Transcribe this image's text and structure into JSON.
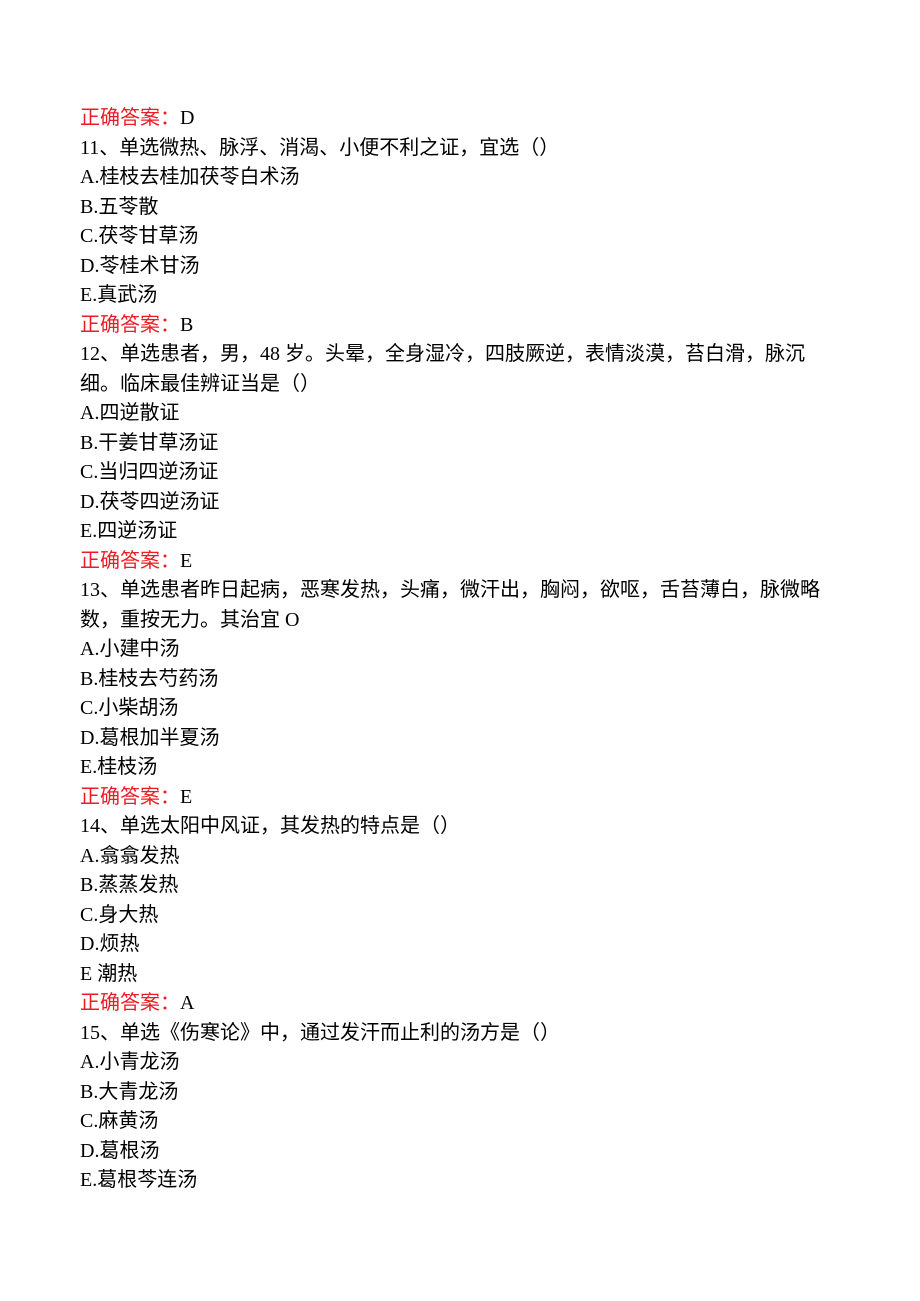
{
  "answer_label": "正确答案：",
  "q10": {
    "answer": "D"
  },
  "q11": {
    "stem": "11、单选微热、脉浮、消渴、小便不利之证，宜选（）",
    "A": "A.桂枝去桂加茯苓白术汤",
    "B": "B.五苓散",
    "C": "C.茯苓甘草汤",
    "D": "D.苓桂术甘汤",
    "E": "E.真武汤",
    "answer": "B"
  },
  "q12": {
    "stem": "12、单选患者，男，48 岁。头晕，全身湿冷，四肢厥逆，表情淡漠，苔白滑，脉沉细。临床最佳辨证当是（）",
    "A": "A.四逆散证",
    "B": "B.干姜甘草汤证",
    "C": "C.当归四逆汤证",
    "D": "D.茯苓四逆汤证",
    "E": "E.四逆汤证",
    "answer": "E"
  },
  "q13": {
    "stem": "13、单选患者昨日起病，恶寒发热，头痛，微汗出，胸闷，欲呕，舌苔薄白，脉微略数，重按无力。其治宜 O",
    "A": "A.小建中汤",
    "B": "B.桂枝去芍药汤",
    "C": "C.小柴胡汤",
    "D": "D.葛根加半夏汤",
    "E": "E.桂枝汤",
    "answer": "E"
  },
  "q14": {
    "stem": "14、单选太阳中风证，其发热的特点是（）",
    "A": "A.翕翕发热",
    "B": "B.蒸蒸发热",
    "C": "C.身大热",
    "D": "D.烦热",
    "E": "E 潮热",
    "answer": "A"
  },
  "q15": {
    "stem": "15、单选《伤寒论》中，通过发汗而止利的汤方是（）",
    "A": "A.小青龙汤",
    "B": "B.大青龙汤",
    "C": "C.麻黄汤",
    "D": "D.葛根汤",
    "E": "E.葛根芩连汤"
  }
}
